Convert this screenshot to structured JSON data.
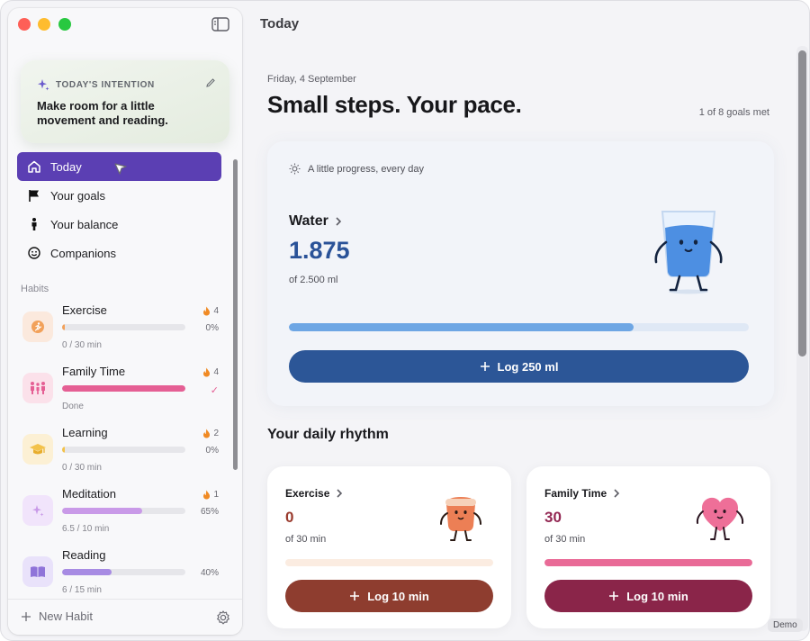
{
  "window": {
    "title": "Today"
  },
  "intention": {
    "label": "TODAY'S INTENTION",
    "text": "Make room for a little movement and reading."
  },
  "nav": {
    "items": [
      {
        "label": "Today",
        "icon": "house-icon",
        "active": true
      },
      {
        "label": "Your goals",
        "icon": "flag-icon",
        "active": false
      },
      {
        "label": "Your balance",
        "icon": "person-icon",
        "active": false
      },
      {
        "label": "Companions",
        "icon": "smiley-icon",
        "active": false
      }
    ]
  },
  "habits": {
    "title": "Habits",
    "items": [
      {
        "name": "Exercise",
        "streak": "4",
        "pct": "0%",
        "sub": "0 / 30 min",
        "progress": 0.02,
        "color": "#f2a15a",
        "icon_bg": "#fbe9dd",
        "icon": "running-icon"
      },
      {
        "name": "Family Time",
        "streak": "4",
        "pct": "✓",
        "sub": "Done",
        "progress": 1.0,
        "color": "#e55f94",
        "icon_bg": "#fbe1ea",
        "icon": "family-icon"
      },
      {
        "name": "Learning",
        "streak": "2",
        "pct": "0%",
        "sub": "0 / 30 min",
        "progress": 0.02,
        "color": "#f3c24a",
        "icon_bg": "#fcf0d4",
        "icon": "graduation-cap-icon"
      },
      {
        "name": "Meditation",
        "streak": "1",
        "pct": "65%",
        "sub": "6.5 / 10 min",
        "progress": 0.65,
        "color": "#c99ae8",
        "icon_bg": "#f1e4fb",
        "icon": "sparkle-icon"
      },
      {
        "name": "Reading",
        "streak": "",
        "pct": "40%",
        "sub": "6 / 15 min",
        "progress": 0.4,
        "color": "#a78be3",
        "icon_bg": "#e9e2fa",
        "icon": "book-icon"
      }
    ]
  },
  "footer": {
    "new_habit": "New Habit"
  },
  "main": {
    "date": "Friday, 4 September",
    "headline": "Small steps. Your pace.",
    "goals_met": "1 of 8 goals met",
    "rhythm_title": "Your daily rhythm"
  },
  "water": {
    "tagline": "A little progress, every day",
    "name": "Water",
    "value": "1.875",
    "of": "of 2.500 ml",
    "progress": 0.75,
    "button": "Log 250 ml",
    "accent": "#2c5697"
  },
  "rhythm": [
    {
      "name": "Exercise",
      "value": "0",
      "of": "of 30 min",
      "progress": 0.0,
      "button": "Log 10 min",
      "value_color": "#9a3b2e",
      "track_color": "#fbece1",
      "fill_color": "#f0a774",
      "button_color": "#8e3d2f",
      "art": "exercise-mascot-icon"
    },
    {
      "name": "Family Time",
      "value": "30",
      "of": "of 30 min",
      "progress": 1.0,
      "button": "Log 10 min",
      "value_color": "#932853",
      "track_color": "#fbe0ea",
      "fill_color": "#e96b97",
      "button_color": "#8a2549",
      "art": "heart-mascot-icon"
    }
  ],
  "badge": "Demo"
}
